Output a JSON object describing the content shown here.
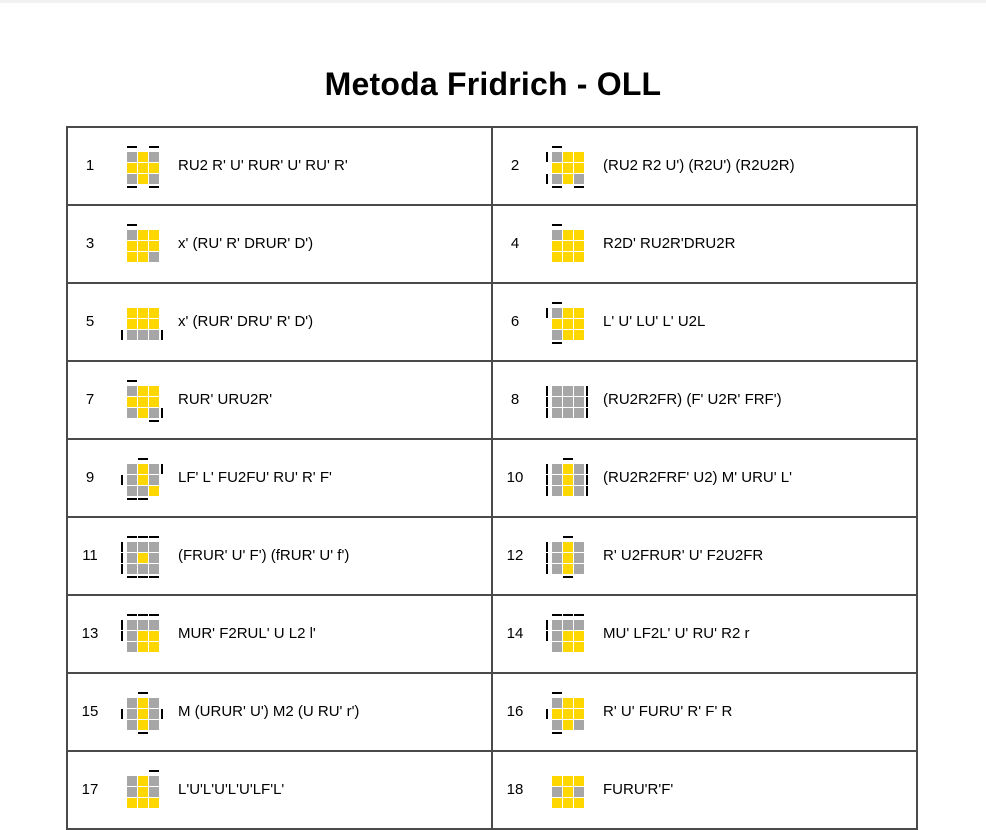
{
  "title": "Metoda Fridrich - OLL",
  "colors": {
    "yellow": "#ffd700",
    "gray": "#a6a6a6",
    "border": "#4a4a4a",
    "mark": "#000000"
  },
  "cases": [
    {
      "number": "1",
      "algorithm": "RU2 R' U' RUR' U' RU' R'",
      "grid": "010111010",
      "marks": "T0T2B0B2"
    },
    {
      "number": "2",
      "algorithm": "(RU2 R2 U') (R2U') (R2U2R)",
      "grid": "011111010",
      "marks": "L0L2T0B0B2"
    },
    {
      "number": "3",
      "algorithm": "x' (RU' R' DRUR' D')",
      "grid": "011111110",
      "marks": "T0"
    },
    {
      "number": "4",
      "algorithm": "R2D' RU2R'DRU2R",
      "grid": "011111111",
      "marks": "T0"
    },
    {
      "number": "5",
      "algorithm": "x' (RUR' DRU' R' D')",
      "grid": "111111000",
      "marks": "L2R2"
    },
    {
      "number": "6",
      "algorithm": "L' U' LU' L' U2L",
      "grid": "011111011",
      "marks": "L0T0B0"
    },
    {
      "number": "7",
      "algorithm": "RUR' URU2R'",
      "grid": "011111010",
      "marks": "T0R2B2"
    },
    {
      "number": "8",
      "algorithm": "(RU2R2FR) (F' U2R' FRF')",
      "grid": "000000000",
      "marks": "L0L1L2R0R1R2"
    },
    {
      "number": "9",
      "algorithm": "LF' L' FU2FU' RU' R' F'",
      "grid": "010010001",
      "marks": "T1R0L1B0B1"
    },
    {
      "number": "10",
      "algorithm": "(RU2R2FRF' U2) M' URU' L'",
      "grid": "010010010",
      "marks": "T1L0L1L2R0R1R2"
    },
    {
      "number": "11",
      "algorithm": "(FRUR' U' F') (fRUR' U' f')",
      "grid": "000010000",
      "marks": "T0T1T2L0L1L2B0B1B2"
    },
    {
      "number": "12",
      "algorithm": "R' U2FRUR' U' F2U2FR",
      "grid": "010010010",
      "marks": "T1L0L1L2B1"
    },
    {
      "number": "13",
      "algorithm": "MUR' F2RUL' U L2 l'",
      "grid": "000011011",
      "marks": "T0T1T2L0L1"
    },
    {
      "number": "14",
      "algorithm": "MU' LF2L' U' RU' R2 r",
      "grid": "000011011",
      "marks": "T0T1T2L0L1"
    },
    {
      "number": "15",
      "algorithm": "M (URUR' U') M2 (U RU' r')",
      "grid": "010010010",
      "marks": "T1L1R1B1"
    },
    {
      "number": "16",
      "algorithm": "R' U' FURU' R' F' R",
      "grid": "011111010",
      "marks": "T0L1B0"
    },
    {
      "number": "17",
      "algorithm": "L'U'L'U'L'U'LF'L'",
      "grid": "010010111",
      "marks": "T2"
    },
    {
      "number": "18",
      "algorithm": "FURU'R'F'",
      "grid": "111010111",
      "marks": ""
    }
  ]
}
